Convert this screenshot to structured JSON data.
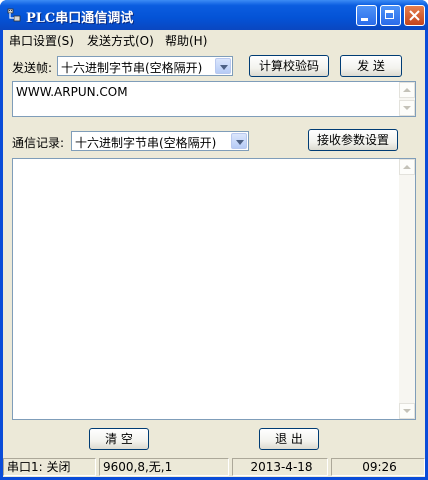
{
  "window": {
    "title": "PLC串口通信调试"
  },
  "menu": {
    "items": [
      "串口设置(S)",
      "发送方式(O)",
      "帮助(H)"
    ]
  },
  "send": {
    "label": "发送帧:",
    "format": "十六进制字节串(空格隔开)",
    "checksum_button": "计算校验码",
    "send_button": "发 送",
    "content": "WWW.ARPUN.COM"
  },
  "receive": {
    "label": "通信记录:",
    "format": "十六进制字节串(空格隔开)",
    "settings_button": "接收参数设置",
    "log": ""
  },
  "actions": {
    "clear_button": "清 空",
    "exit_button": "退 出"
  },
  "status": {
    "port": "串口1: 关闭",
    "params": "9600,8,无,1",
    "date": "2013-4-18",
    "time": "09:26"
  }
}
